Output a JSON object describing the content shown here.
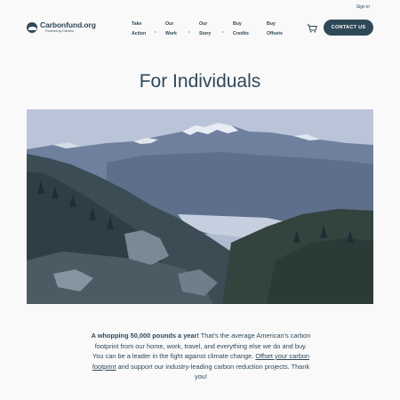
{
  "header": {
    "signin": "Sign in",
    "logo_name": "Carbonfund.org",
    "logo_sub": "Powered by Climevo",
    "nav": [
      {
        "line1": "Take",
        "line2": "Action"
      },
      {
        "line1": "Our",
        "line2": "Work"
      },
      {
        "line1": "Our",
        "line2": "Story"
      },
      {
        "line1": "Buy",
        "line2": "Credits"
      },
      {
        "line1": "Buy",
        "line2": "Offsets"
      }
    ],
    "cart_icon": "cart-icon",
    "contact_label": "CONTACT US"
  },
  "page": {
    "title": "For Individuals"
  },
  "hero": {
    "icon": "mountain-landscape-photo"
  },
  "intro": {
    "bold": "A whopping 50,000 pounds a year!",
    "text1": " That's the average American's carbon footprint from our home, work, travel, and everything else we do and buy. You can be a leader in the fight against climate change. ",
    "link": "Offset your carbon footprint",
    "text2": " and support our industry-leading carbon reduction projects. Thank you!"
  },
  "colors": {
    "brand": "#2f4858",
    "background": "#f9f9f9"
  }
}
